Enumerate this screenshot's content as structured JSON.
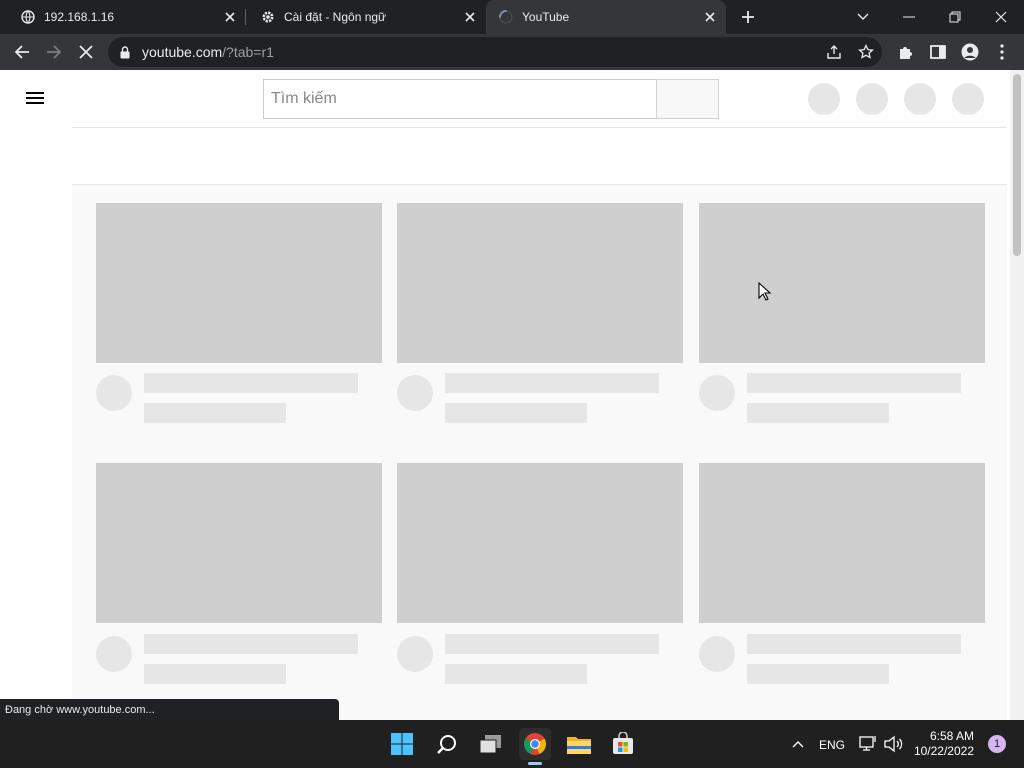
{
  "tabs": [
    {
      "title": "192.168.1.16",
      "icon": "globe-icon"
    },
    {
      "title": "Cài đặt - Ngôn ngữ",
      "icon": "gear-icon"
    },
    {
      "title": "YouTube",
      "icon": "loading-spinner-icon",
      "active": true
    }
  ],
  "toolbar": {
    "url_host": "youtube.com",
    "url_rest": "/?tab=r1"
  },
  "page": {
    "search_placeholder": "Tìm kiếm",
    "status_text": "Đang chờ www.youtube.com..."
  },
  "taskbar": {
    "language": "ENG",
    "time": "6:58 AM",
    "date": "10/22/2022",
    "notification_count": "1"
  },
  "colors": {
    "tabstrip": "#202124",
    "toolbar": "#35363a",
    "skeleton_thumb": "#cfcfcf",
    "skeleton_line": "#e6e6e6",
    "taskbar": "#202020"
  }
}
